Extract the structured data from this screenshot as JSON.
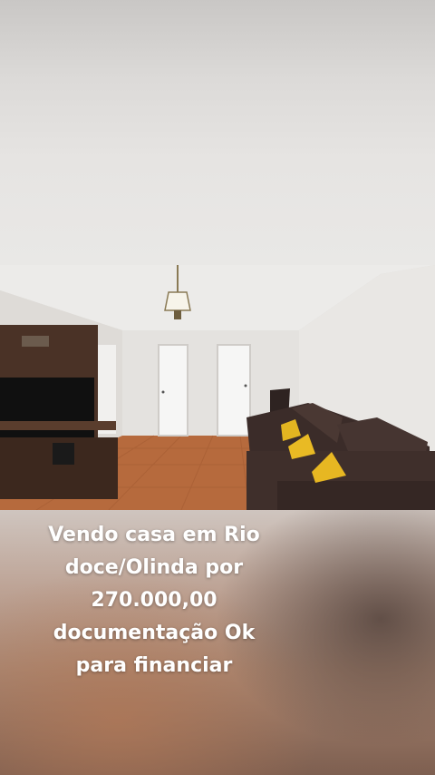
{
  "caption": {
    "line1": "Vendo casa em Rio",
    "line2": "doce/Olinda por",
    "line3": "270.000,00",
    "line4": "documentação Ok",
    "line5": "para financiar"
  },
  "photo": {
    "subject": "living room with sofa, yellow pillows, TV panel, tiled floor, ceiling lamp"
  },
  "colors": {
    "sofa": "#3e2f2b",
    "pillow": "#e8b822",
    "floor": "#b86a3e",
    "wall": "#e8e6e3",
    "tv_panel": "#4a3226"
  }
}
